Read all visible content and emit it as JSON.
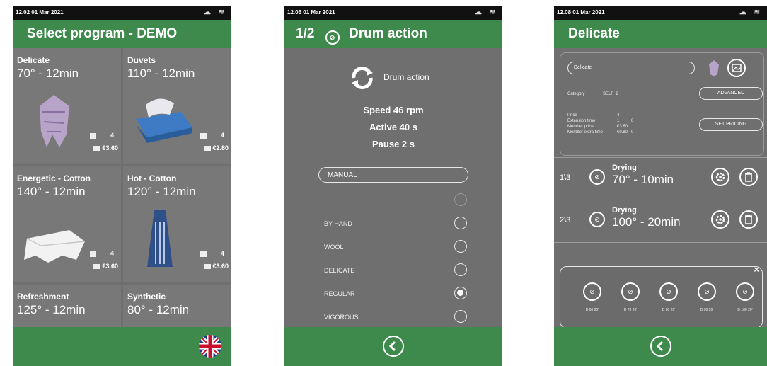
{
  "screen1": {
    "status_time": "12.02 01 Mar 2021",
    "title": "Select program - DEMO",
    "programs": [
      {
        "name": "Delicate",
        "temp": "70° - 12min",
        "count": "4",
        "price": "€3.60"
      },
      {
        "name": "Duvets",
        "temp": "110° - 12min",
        "count": "4",
        "price": "€2.80"
      },
      {
        "name": "Energetic - Cotton",
        "temp": "140° - 12min",
        "count": "4",
        "price": "€3.60"
      },
      {
        "name": "Hot - Cotton",
        "temp": "120° - 12min",
        "count": "4",
        "price": "€3.60"
      },
      {
        "name": "Refreshment",
        "temp": "125° - 12min"
      },
      {
        "name": "Synthetic",
        "temp": "80° - 12min"
      }
    ],
    "language_icon": "uk-flag-icon"
  },
  "screen2": {
    "status_time": "12.06 01 Mar 2021",
    "step": "1/2",
    "title": "Drum action",
    "drum_label": "Drum action",
    "speed": "Speed 46 rpm",
    "active": "Active 40 s",
    "pause": "Pause 2 s",
    "mode": "MANUAL",
    "options": [
      {
        "label": "",
        "selected": false
      },
      {
        "label": "BY HAND",
        "selected": false
      },
      {
        "label": "WOOL",
        "selected": false
      },
      {
        "label": "DELICATE",
        "selected": false
      },
      {
        "label": "REGULAR",
        "selected": true
      },
      {
        "label": "VIGOROUS",
        "selected": false
      }
    ]
  },
  "screen3": {
    "status_time": "12.08 01 Mar 2021",
    "title": "Delicate",
    "name_field": "Delicate",
    "category_label": "Category",
    "category_value": "SELF_2",
    "advanced_label": "ADVANCED",
    "set_pricing_label": "SET PRICING",
    "price_rows": [
      {
        "label": "Price",
        "value": "4",
        "extra": ""
      },
      {
        "label": "Extension time",
        "value": "1",
        "extra": "0"
      },
      {
        "label": "Member price",
        "value": "€3.60",
        "extra": ""
      },
      {
        "label": "Member extra time",
        "value": "€0.80",
        "extra": "0"
      }
    ],
    "steps": [
      {
        "index": "1\\3",
        "label": "Drying",
        "value": "70° - 10min"
      },
      {
        "index": "2\\3",
        "label": "Drying",
        "value": "100° - 20min"
      }
    ],
    "popup_items": [
      "D 60 20'",
      "D 70 20'",
      "D 80 20'",
      "D 90 20'",
      "D 100 20'"
    ]
  }
}
